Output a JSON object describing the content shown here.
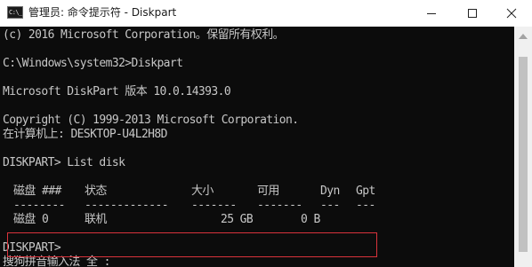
{
  "window": {
    "title": "管理员: 命令提示符 - Diskpart",
    "icon_text": "C:\\_",
    "icon": "cmd-icon",
    "controls": [
      "minimize-icon",
      "maximize-icon",
      "close-icon"
    ]
  },
  "console": {
    "lines": [
      "(c) 2016 Microsoft Corporation。保留所有权利。",
      "",
      "C:\\Windows\\system32>Diskpart",
      "",
      "Microsoft DiskPart 版本 10.0.14393.0",
      "",
      "Copyright (C) 1999-2013 Microsoft Corporation.",
      "在计算机上: DESKTOP-U4L2H8D",
      "",
      "DISKPART> List disk"
    ],
    "table": {
      "headers": [
        "磁盘 ###",
        "状态",
        "大小",
        "可用",
        "Dyn",
        "Gpt"
      ],
      "separators": [
        "--------",
        "-------------",
        "-------",
        "-------",
        "---",
        "---"
      ],
      "rows": [
        [
          "磁盘 0",
          "联机",
          "25 GB",
          "0 B",
          "",
          ""
        ]
      ]
    },
    "prompt": "DISKPART>",
    "ime_status": "搜狗拼音输入法 全 :"
  },
  "colors": {
    "console_bg": "#0c0c0c",
    "console_text": "#c7c7c7",
    "highlight_border": "#d9333b"
  }
}
